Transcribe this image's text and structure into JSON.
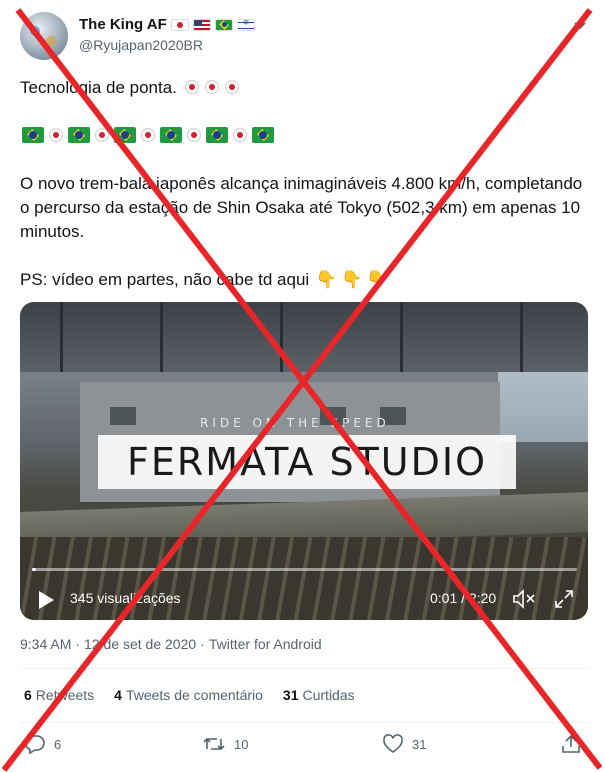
{
  "tweet": {
    "display_name": "The King AF",
    "handle": "@Ryujapan2020BR",
    "line1": "Tecnologia de ponta.",
    "paragraph": "O novo trem-bala japonês alcança inimagináveis 4.800 km/h, completando o percurso da estação de Shin Osaka até Tokyo (502,3 km) em apenas 10 minutos.",
    "ps": "PS: vídeo em partes, não cabe td aqui"
  },
  "video": {
    "banner_title": "FERMATA STUDIO",
    "banner_sub": "RIDE ON THE SPEED",
    "views": "345 visualizações",
    "time": "0:01 / 2:20",
    "progress": 0.007
  },
  "meta": {
    "time": "9:34 AM",
    "sep1": "·",
    "date": "12 de set de 2020",
    "sep2": "·",
    "source": "Twitter for Android"
  },
  "stats": {
    "retweets_count": "6",
    "retweets_label": "Retweets",
    "quotes_count": "4",
    "quotes_label": "Tweets de comentário",
    "likes_count": "31",
    "likes_label": "Curtidas"
  },
  "actions": {
    "reply_count": "6",
    "retweet_count": "10",
    "like_count": "31"
  },
  "icons": {
    "more": "chevron-down-icon",
    "reply": "reply-icon",
    "retweet": "retweet-icon",
    "like": "heart-icon",
    "share": "share-icon",
    "play": "play-icon",
    "mute": "mute-icon",
    "fullscreen": "fullscreen-icon"
  },
  "colors": {
    "cross": "#e8262a",
    "muted_text": "#536471",
    "text": "#0f1419"
  }
}
